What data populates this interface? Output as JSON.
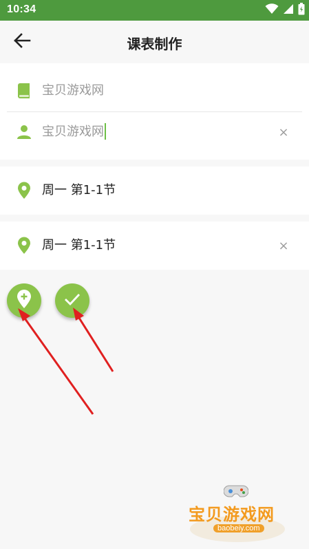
{
  "status": {
    "time": "10:34"
  },
  "header": {
    "title": "课表制作"
  },
  "course": {
    "name_placeholder": "宝贝游戏网",
    "teacher_value": "宝贝游戏网",
    "clear": "×"
  },
  "slots": [
    {
      "text": "周一 第1-1节"
    },
    {
      "text": "周一 第1-1节",
      "clear": "×"
    }
  ],
  "watermark": {
    "title": "宝贝游戏网",
    "domain": "baobeiy.com"
  },
  "icons": {
    "back": "arrow-left-icon",
    "book": "book-icon",
    "person": "person-icon",
    "location": "location-pin-icon",
    "add_location": "add-location-icon",
    "confirm": "check-icon",
    "wifi": "wifi-icon",
    "signal": "signal-icon",
    "battery": "battery-icon"
  },
  "colors": {
    "status_bar": "#4e9a3e",
    "accent": "#8bc34a",
    "annotation_arrow": "#e02020"
  }
}
